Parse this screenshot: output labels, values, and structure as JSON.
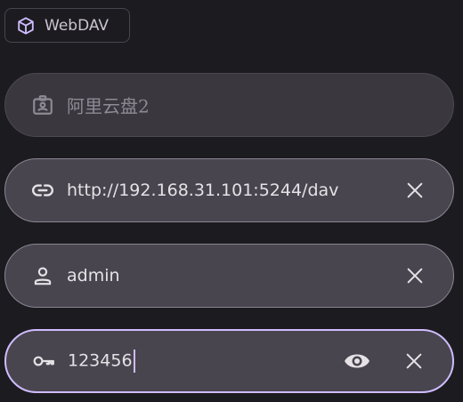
{
  "chip": {
    "label": "WebDAV",
    "icon": "cube-icon"
  },
  "fields": {
    "name": {
      "value": "阿里云盘2",
      "icon": "id-badge-icon"
    },
    "url": {
      "value": "http://192.168.31.101:5244/dav",
      "icon": "link-icon"
    },
    "username": {
      "value": "admin",
      "icon": "person-icon"
    },
    "password": {
      "value": "123456",
      "icon": "key-icon"
    }
  },
  "colors": {
    "background": "#1c1b1f",
    "field_fill": "#49454f",
    "focus_accent": "#cfbcff",
    "text": "#e6e1e5"
  }
}
